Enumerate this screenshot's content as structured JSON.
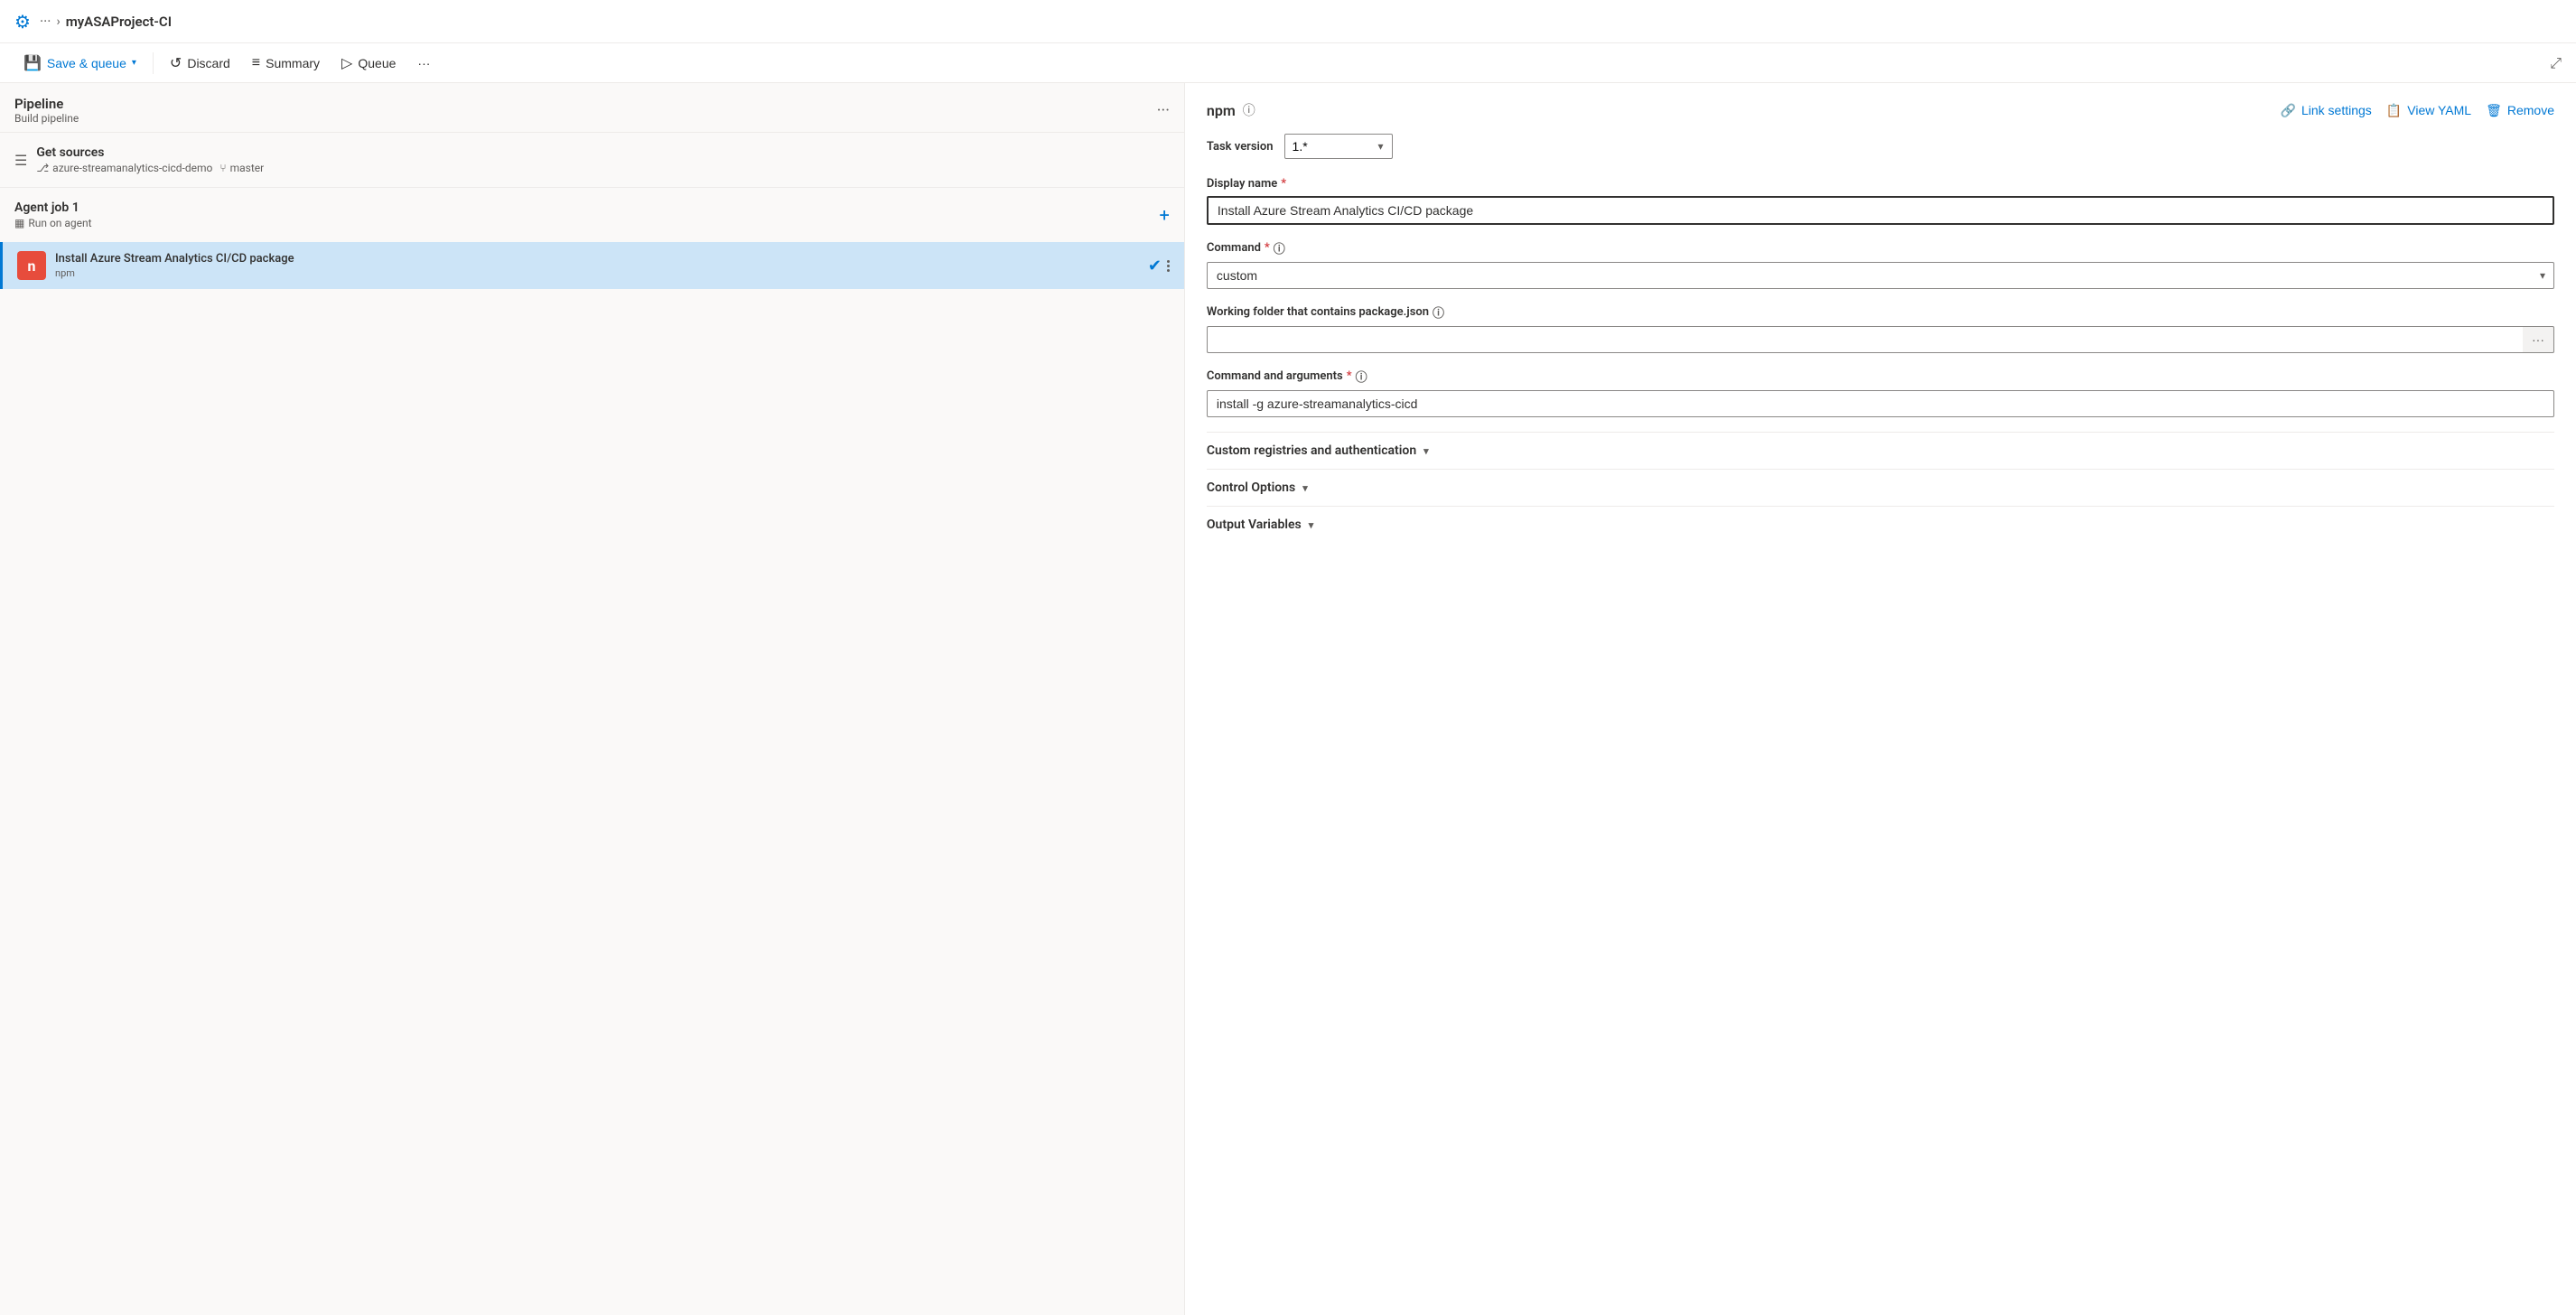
{
  "topBar": {
    "logo": "⚙",
    "dots": "···",
    "chevron": ">",
    "title": "myASAProject-CI"
  },
  "toolbar": {
    "saveAndQueue": "Save & queue",
    "discard": "Discard",
    "summary": "Summary",
    "queue": "Queue",
    "more": "···"
  },
  "leftPanel": {
    "title": "Pipeline",
    "subtitle": "Build pipeline",
    "getSources": {
      "title": "Get sources",
      "repo": "azure-streamanalytics-cicd-demo",
      "branch": "master"
    },
    "agentJob": {
      "title": "Agent job 1",
      "subtitle": "Run on agent"
    },
    "task": {
      "title": "Install Azure Stream Analytics CI/CD package",
      "subtitle": "npm",
      "iconLetter": "n"
    }
  },
  "rightPanel": {
    "npmTitle": "npm",
    "taskVersion": {
      "label": "Task version",
      "value": "1.*"
    },
    "displayName": {
      "label": "Display name",
      "required": true,
      "value": "Install Azure Stream Analytics CI/CD package"
    },
    "command": {
      "label": "Command",
      "required": true,
      "value": "custom"
    },
    "workingFolder": {
      "label": "Working folder that contains package.json",
      "value": ""
    },
    "commandAndArguments": {
      "label": "Command and arguments",
      "required": true,
      "value": "install -g azure-streamanalytics-cicd"
    },
    "customRegistries": {
      "label": "Custom registries and authentication"
    },
    "controlOptions": {
      "label": "Control Options"
    },
    "outputVariables": {
      "label": "Output Variables"
    },
    "actions": {
      "linkSettings": "Link settings",
      "viewYaml": "View YAML",
      "remove": "Remove"
    }
  }
}
